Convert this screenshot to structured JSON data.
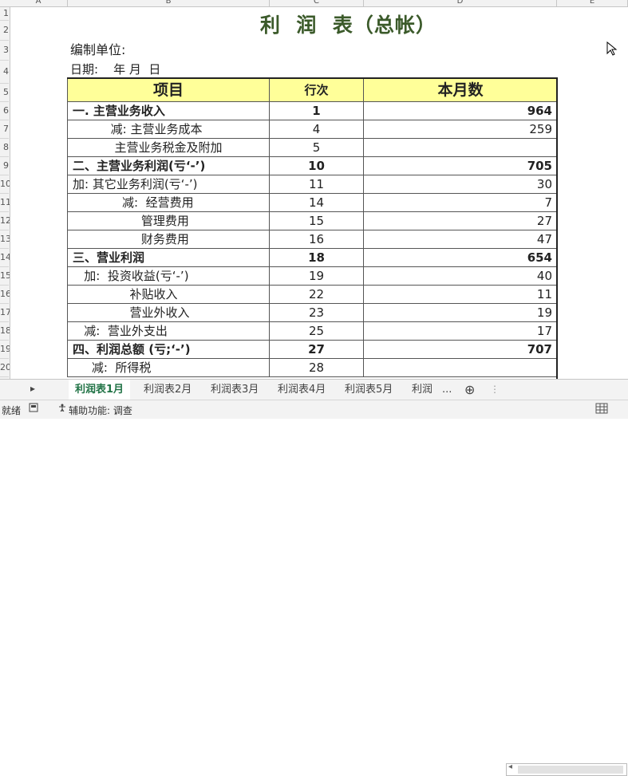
{
  "columns": [
    "A",
    "B",
    "C",
    "D",
    "E"
  ],
  "rows": [
    "1",
    "2",
    "3",
    "4",
    "5",
    "6",
    "7",
    "8",
    "9",
    "10",
    "11",
    "12",
    "13",
    "14",
    "15",
    "16",
    "17",
    "18",
    "19",
    "20"
  ],
  "report": {
    "title": "利  润  表（总帐）",
    "unit_label": "编制单位:",
    "date_label": "日期:    年 月  日",
    "headers": {
      "item": "项目",
      "line": "行次",
      "amount": "本月数"
    },
    "lines": [
      {
        "item": "一. 主营业务收入",
        "line": "1",
        "amount": "964",
        "bold": true
      },
      {
        "item": "          减: 主营业务成本",
        "line": "4",
        "amount": "259",
        "bold": false
      },
      {
        "item": "           主营业务税金及附加",
        "line": "5",
        "amount": "",
        "bold": false
      },
      {
        "item": "二、主营业务利润(亏‘-’)",
        "line": "10",
        "amount": "705",
        "bold": true
      },
      {
        "item": "加: 其它业务利润(亏‘-’)",
        "line": "11",
        "amount": "30",
        "bold": false
      },
      {
        "item": "             减:  经营费用",
        "line": "14",
        "amount": "7",
        "bold": false
      },
      {
        "item": "                  管理费用",
        "line": "15",
        "amount": "27",
        "bold": false
      },
      {
        "item": "                  财务费用",
        "line": "16",
        "amount": "47",
        "bold": false
      },
      {
        "item": "三、营业利润",
        "line": "18",
        "amount": "654",
        "bold": true
      },
      {
        "item": "   加:  投资收益(亏‘-’)",
        "line": "19",
        "amount": "40",
        "bold": false
      },
      {
        "item": "               补贴收入",
        "line": "22",
        "amount": "11",
        "bold": false
      },
      {
        "item": "               营业外收入",
        "line": "23",
        "amount": "19",
        "bold": false
      },
      {
        "item": "   减:  营业外支出",
        "line": "25",
        "amount": "17",
        "bold": false
      },
      {
        "item": "四、利润总额 (亏;‘-’)",
        "line": "27",
        "amount": "707",
        "bold": true
      },
      {
        "item": "     减:  所得税",
        "line": "28",
        "amount": "",
        "bold": false
      }
    ]
  },
  "sheets": [
    "利润表1月",
    "利润表2月",
    "利润表3月",
    "利润表4月",
    "利润表5月",
    "利润表"
  ],
  "more_tabs": "...",
  "add_sheet": "⊕",
  "status_bar": {
    "mode": "就绪",
    "accessibility": "辅助功能: 调查"
  }
}
